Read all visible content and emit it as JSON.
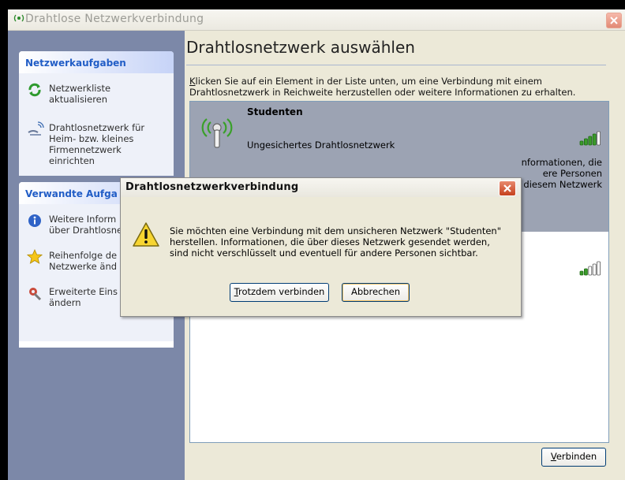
{
  "window": {
    "title": "Drahtlose Netzwerkverbindung",
    "close_icon": "close-icon"
  },
  "sidebar": {
    "box1": {
      "heading": "Netzwerkaufgaben",
      "items": [
        {
          "label": "Netzwerkliste aktualisieren",
          "icon": "refresh-icon"
        },
        {
          "label_lines": [
            "Drahtlosnetzwerk für",
            "Heim- bzw. kleines",
            "Firmennetzwerk einrichten"
          ],
          "icon": "home-network-icon"
        }
      ]
    },
    "box2": {
      "heading": "Verwandte Aufga",
      "items": [
        {
          "label_lines": [
            "Weitere Inform",
            "über Drahtlosne"
          ],
          "icon": "info-icon"
        },
        {
          "label_lines": [
            "Reihenfolge de",
            "Netzwerke änd"
          ],
          "icon": "star-icon"
        },
        {
          "label_lines": [
            "Erweiterte Eins",
            "ändern"
          ],
          "icon": "settings-icon"
        }
      ]
    }
  },
  "main": {
    "heading": "Drahtlosnetzwerk auswählen",
    "instruction_first_letter": "K",
    "instruction_rest_line1": "licken Sie auf ein Element in der Liste unten, um eine Verbindung mit einem",
    "instruction_line2": "Drahtlosnetzwerk in Reichweite herzustellen oder weitere Informationen zu erhalten.",
    "networks": [
      {
        "name": "Studenten",
        "type": "Ungesichertes Drahtlosnetzwerk",
        "desc_line1": "nformationen, die",
        "desc_line2": "ere Personen",
        "desc_line3": "it diesem Netzwerk",
        "signal_bars": 4
      },
      {
        "signal_bars": 2
      }
    ],
    "connect_button": {
      "first": "V",
      "rest": "erbinden"
    }
  },
  "dialog": {
    "title": "Drahtlosnetzwerkverbindung",
    "message_line1": "Sie möchten eine Verbindung mit dem unsicheren Netzwerk \"Studenten\"",
    "message_line2": "herstellen. Informationen, die über dieses Netzwerk gesendet werden,",
    "message_line3": "sind nicht verschlüsselt und eventuell für andere Personen sichtbar.",
    "connect_anyway": {
      "first": "T",
      "rest": "rotzdem verbinden"
    },
    "cancel": "Abbrechen",
    "icon": "warning-icon"
  },
  "colors": {
    "sidebar_bg": "#7c88a8",
    "task_heading": "#215dc6",
    "selected_item": "#9ca3b3",
    "signal_green": "#3a9a2a"
  }
}
